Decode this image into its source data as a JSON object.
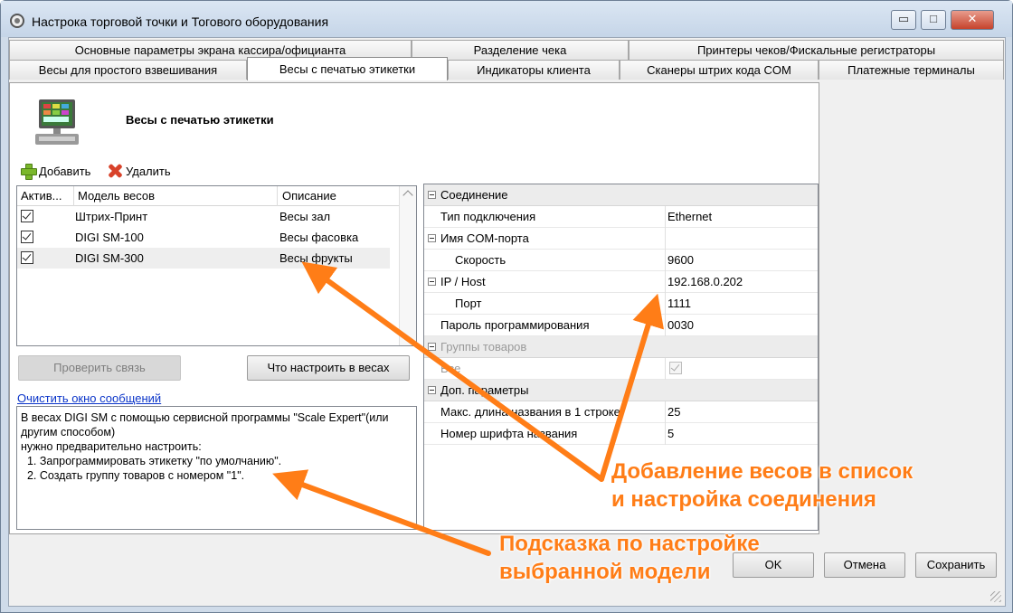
{
  "window": {
    "title": "Настрока торговой точки и Тогового оборудования",
    "minimize_label": "▭",
    "maximize_label": "□",
    "close_label": "✕"
  },
  "tabs": {
    "row_top": [
      "Основные параметры экрана кассира/официанта",
      "Разделение чека",
      "Принтеры чеков/Фискальные регистраторы"
    ],
    "row_bottom": [
      "Весы для простого взвешивания",
      "Весы с печатью этикетки",
      "Индикаторы клиента",
      "Сканеры штрих кода COM",
      "Платежные терминалы"
    ],
    "active": "Весы с печатью этикетки"
  },
  "panel": {
    "title": "Весы с печатью этикетки",
    "image_icon": "scale-printer-icon"
  },
  "toolbar": {
    "add_label": "Добавить",
    "delete_label": "Удалить"
  },
  "grid": {
    "columns": [
      "Актив...",
      "Модель весов",
      "Описание"
    ],
    "rows": [
      {
        "active": true,
        "model": "Штрих-Принт",
        "description": "Весы зал"
      },
      {
        "active": true,
        "model": "DIGI SM-100",
        "description": "Весы фасовка"
      },
      {
        "active": true,
        "model": "DIGI SM-300",
        "description": "Весы фрукты"
      }
    ]
  },
  "buttons": {
    "check_connection": "Проверить связь",
    "what_to_configure": "Что настроить в весах",
    "ok": "OK",
    "cancel": "Отмена",
    "save": "Сохранить"
  },
  "messages": {
    "clear_link": "Очистить окно сообщений",
    "text": "В весах DIGI SM с помощью сервисной программы \"Scale Expert\"(или другим способом)\nнужно предварительно настроить:\n  1. Запрограммировать этикетку \"по умолчанию\".\n  2. Создать группу товаров с номером \"1\"."
  },
  "properties": {
    "connection_cat": "Соединение",
    "conn_type_name": "Тип подключения",
    "conn_type_value": "Ethernet",
    "com_port_name": "Имя COM-порта",
    "com_port_value": "",
    "speed_name": "Скорость",
    "speed_value": "9600",
    "ip_host_name": "IP / Host",
    "ip_host_value": "192.168.0.202",
    "port_name": "Порт",
    "port_value": "1111",
    "password_name": "Пароль программирования",
    "password_value": "0030",
    "groups_cat": "Группы товаров",
    "all_name": "Все",
    "all_value": true,
    "extra_cat": "Доп. параметры",
    "max_name_len_name": "Макс. длина названия в 1 строке",
    "max_name_len_value": "25",
    "font_num_name": "Номер шрифта названия",
    "font_num_value": "5"
  },
  "annotations": {
    "callout_right_1": "Добавление весов в список",
    "callout_right_2": "и настройка соединения",
    "callout_bottom_1": "Подсказка по настройке",
    "callout_bottom_2": "выбранной модели",
    "color": "#ff7d17"
  }
}
